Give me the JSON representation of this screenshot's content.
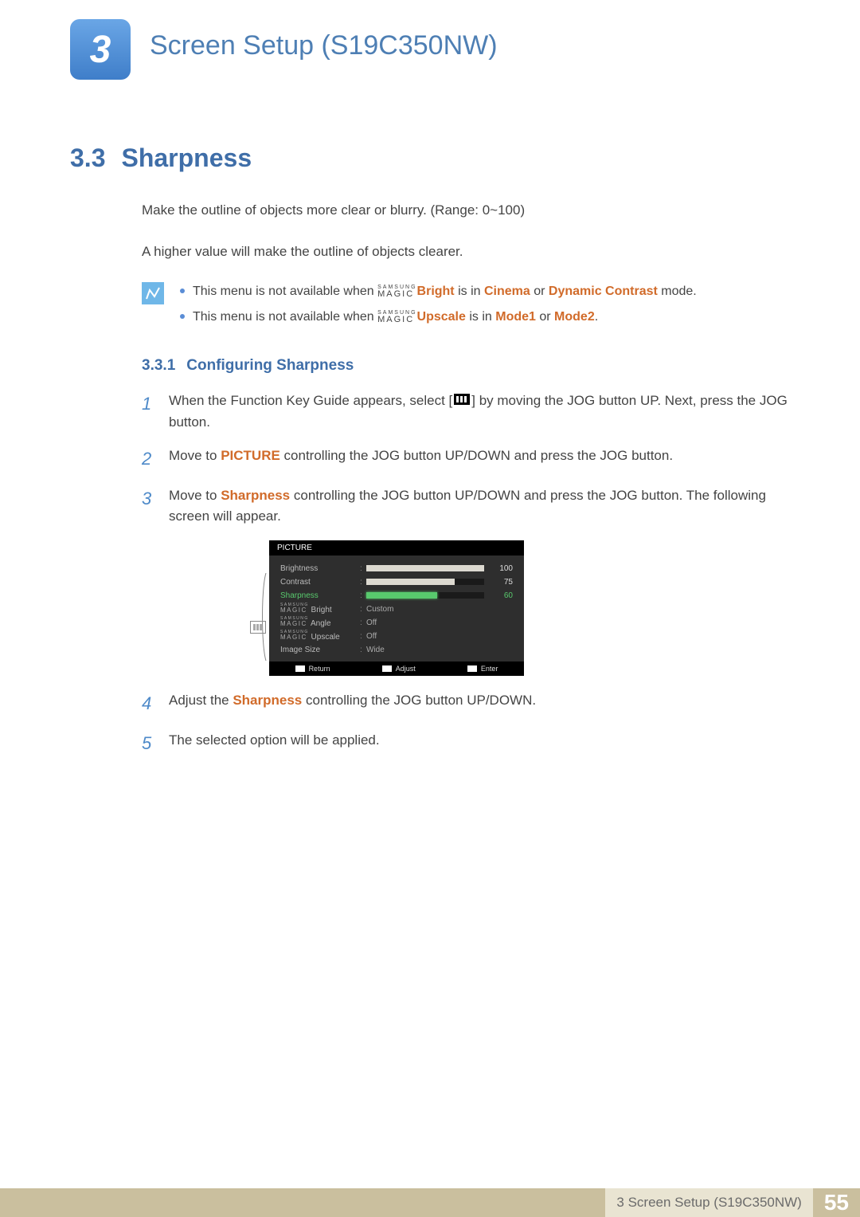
{
  "chapter": {
    "number": "3",
    "title": "Screen Setup (S19C350NW)"
  },
  "section": {
    "number": "3.3",
    "title": "Sharpness"
  },
  "intro": {
    "p1": "Make the outline of objects more clear or blurry. (Range: 0~100)",
    "p2": "A higher value will make the outline of objects clearer."
  },
  "notes": {
    "n1_pre": "This menu is not available when ",
    "n1_brand_top": "SAMSUNG",
    "n1_brand_bot": "MAGIC",
    "n1_word": "Bright",
    "n1_mid": " is in ",
    "n1_mode1": "Cinema",
    "n1_or": " or ",
    "n1_mode2": "Dynamic Contrast",
    "n1_post": " mode.",
    "n2_pre": "This menu is not available when ",
    "n2_brand_top": "SAMSUNG",
    "n2_brand_bot": "MAGIC",
    "n2_word": "Upscale",
    "n2_mid": " is in ",
    "n2_mode1": "Mode1",
    "n2_or": " or ",
    "n2_mode2": "Mode2",
    "n2_post": "."
  },
  "subsection": {
    "number": "3.3.1",
    "title": "Configuring Sharpness"
  },
  "steps": {
    "s1_num": "1",
    "s1_a": "When the Function Key Guide appears, select ",
    "s1_b": " by moving the JOG button UP. Next, press the JOG button.",
    "s2_num": "2",
    "s2_a": "Move to ",
    "s2_word": "PICTURE",
    "s2_b": " controlling the JOG button UP/DOWN and press the JOG button.",
    "s3_num": "3",
    "s3_a": "Move to ",
    "s3_word": "Sharpness",
    "s3_b": " controlling the JOG button UP/DOWN and press the JOG button. The following screen will appear.",
    "s4_num": "4",
    "s4_a": "Adjust the ",
    "s4_word": "Sharpness",
    "s4_b": " controlling the JOG button UP/DOWN.",
    "s5_num": "5",
    "s5_a": "The selected option will be applied."
  },
  "osd": {
    "title": "PICTURE",
    "rows": {
      "brightness": {
        "label": "Brightness",
        "value": "100",
        "fill": 100
      },
      "contrast": {
        "label": "Contrast",
        "value": "75",
        "fill": 75
      },
      "sharpness": {
        "label": "Sharpness",
        "value": "60",
        "fill": 60
      },
      "bright": {
        "label_top": "SAMSUNG",
        "label_bot": "MAGIC",
        "suffix": " Bright",
        "value": "Custom"
      },
      "angle": {
        "label_top": "SAMSUNG",
        "label_bot": "MAGIC",
        "suffix": " Angle",
        "value": "Off"
      },
      "upscale": {
        "label_top": "SAMSUNG",
        "label_bot": "MAGIC",
        "suffix": " Upscale",
        "value": "Off"
      },
      "imagesize": {
        "label": "Image Size",
        "value": "Wide"
      }
    },
    "footer": {
      "return": "Return",
      "adjust": "Adjust",
      "enter": "Enter"
    }
  },
  "footer": {
    "text": "3 Screen Setup (S19C350NW)",
    "page": "55"
  }
}
